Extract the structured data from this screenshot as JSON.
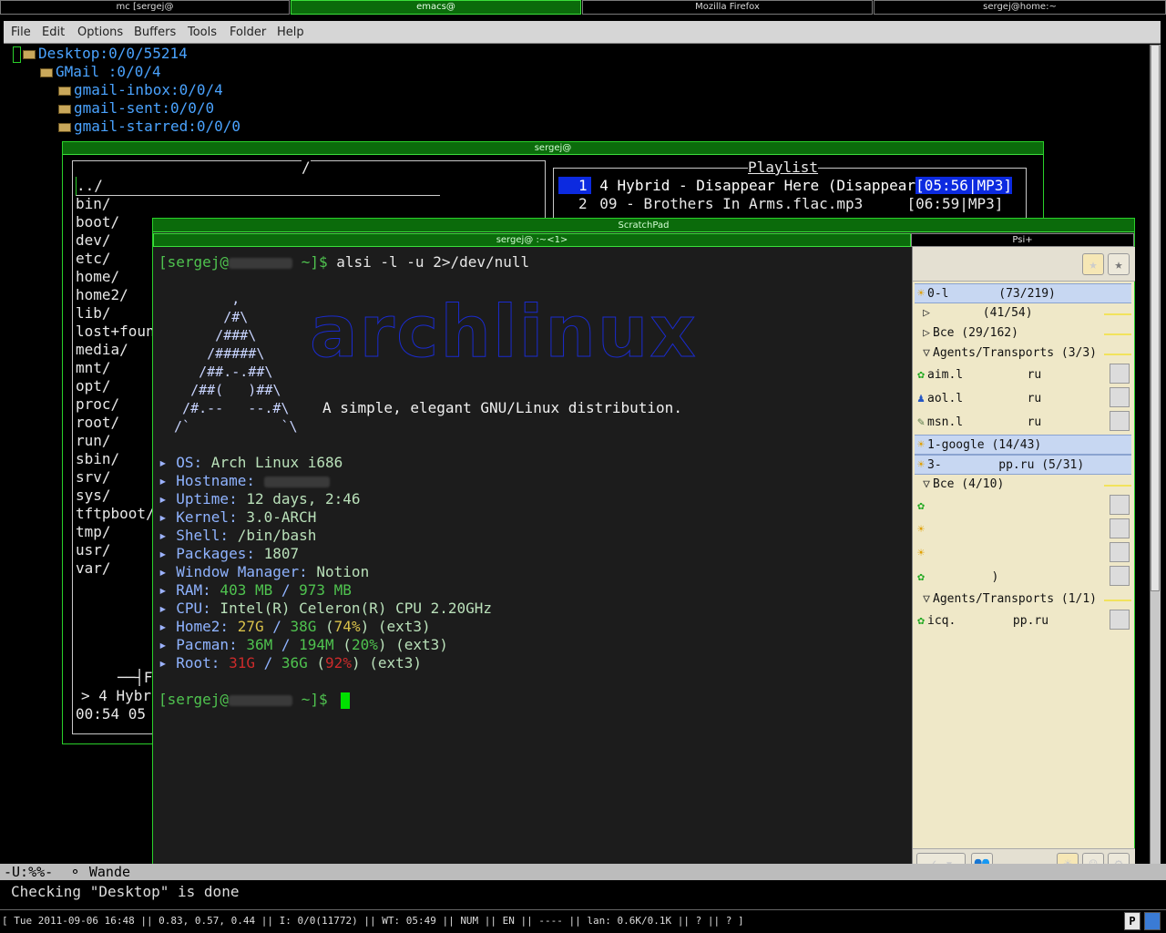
{
  "top_tabs": [
    {
      "label": "mc [sergej@",
      "active": false
    },
    {
      "label": "emacs@",
      "active": true
    },
    {
      "label": "Mozilla Firefox",
      "active": false
    },
    {
      "label": "sergej@home:~",
      "active": false
    }
  ],
  "emacs": {
    "menu": [
      "File",
      "Edit",
      "Options",
      "Buffers",
      "Tools",
      "Folder",
      "Help"
    ],
    "tree": [
      "Desktop:0/0/55214",
      "GMail :0/0/4",
      "gmail-inbox:0/0/4",
      "gmail-sent:0/0/0",
      "gmail-starred:0/0/0"
    ],
    "modeline": "-U:%%-  ⚬ Wande",
    "echo": "Checking \"Desktop\" is done"
  },
  "mc": {
    "title": "sergej@",
    "panel_path": "/",
    "dirs": [
      "../",
      "bin/",
      "boot/",
      "dev/",
      "etc/",
      "home/",
      "home2/",
      "lib/",
      "lost+foun",
      "media/",
      "mnt/",
      "opt/",
      "proc/",
      "root/",
      "run/",
      "sbin/",
      "srv/",
      "sys/",
      "tftpboot/",
      "tmp/",
      "usr/",
      "var/"
    ],
    "playlist_title": "Playlist",
    "playlist": [
      {
        "num": "1",
        "title": "4 Hybrid - Disappear Here (Disappear",
        "info": "[05:56|MP3]"
      },
      {
        "num": "2",
        "title": "09 - Brothers In Arms.flac.mp3",
        "info": "[06:59|MP3]"
      }
    ],
    "file_label": "File",
    "now_playing": "> 4 Hybr",
    "time": "00:54 05"
  },
  "scratchpad": {
    "title": "ScratchPad",
    "term_tab": "sergej@        :~<1>",
    "psi_tab": "Psi+",
    "prompt_user": "[sergej@",
    "prompt_end": " ~]$",
    "command": " alsi -l -u 2>/dev/null",
    "tagline": "A simple, elegant GNU/Linux distribution.",
    "logo_word": "archlinux",
    "info": [
      {
        "label": "OS:",
        "value": " Arch Linux i686"
      },
      {
        "label": "Hostname:",
        "value": " "
      },
      {
        "label": "Uptime:",
        "value": " 12 days, 2:46"
      },
      {
        "label": "Kernel:",
        "value": " 3.0-ARCH"
      },
      {
        "label": "Shell:",
        "value": " /bin/bash"
      },
      {
        "label": "Packages:",
        "value": " 1807"
      },
      {
        "label": "Window Manager:",
        "value": " Notion"
      }
    ],
    "ram": {
      "label": "RAM:",
      "used": " 403 MB",
      "sep": " / ",
      "total": "973 MB"
    },
    "cpu": {
      "label": "CPU:",
      "value": " Intel(R) Celeron(R) CPU 2.20GHz"
    },
    "disks": [
      {
        "label": "Home2:",
        "used": " 27G",
        "total": "38G",
        "pct": "74%",
        "fs": " (ext3)",
        "color": "yellow"
      },
      {
        "label": "Pacman:",
        "used": " 36M",
        "total": "194M",
        "pct": "20%",
        "fs": " (ext3)",
        "color": "green"
      },
      {
        "label": "Root:",
        "used": " 31G",
        "total": "36G",
        "pct": "92%",
        "fs": " (ext3)",
        "color": "red"
      }
    ]
  },
  "psi": {
    "rows": [
      {
        "type": "acct",
        "text": "0-l       (73/219)",
        "icon": "sun"
      },
      {
        "type": "grp",
        "text": "       (41/54)",
        "icon": "tri-right"
      },
      {
        "type": "grp",
        "text": "Bce (29/162)",
        "icon": "tri-right"
      },
      {
        "type": "grp",
        "text": "Agents/Transports (3/3)",
        "icon": "tri-down"
      },
      {
        "type": "contact",
        "text": "aim.l         ru",
        "icon": "flower"
      },
      {
        "type": "contact",
        "text": "aol.l         ru",
        "icon": "aim"
      },
      {
        "type": "contact",
        "text": "msn.l         ru",
        "icon": "msn"
      },
      {
        "type": "acct",
        "text": "1-google (14/43)",
        "icon": "sun"
      },
      {
        "type": "acct",
        "text": "3-        pp.ru (5/31)",
        "icon": "sun"
      },
      {
        "type": "grp",
        "text": "Bce (4/10)",
        "icon": "tri-down"
      },
      {
        "type": "contact",
        "text": "         ",
        "icon": "flower"
      },
      {
        "type": "contact",
        "text": "         ",
        "icon": "sun"
      },
      {
        "type": "contact",
        "text": "         ",
        "icon": "sun"
      },
      {
        "type": "contact",
        "text": "         )",
        "icon": "flower"
      },
      {
        "type": "grp",
        "text": "Agents/Transports (1/1)",
        "icon": "tri-down"
      },
      {
        "type": "contact",
        "text": "icq.        pp.ru",
        "icon": "flower"
      }
    ]
  },
  "statusbar": "[ Tue 2011-09-06 16:48 || 0.83, 0.57, 0.44 || I: 0/0(11772) || WT: 05:49 || NUM || EN || ---- || lan: 0.6K/0.1K || ? || ? ]"
}
